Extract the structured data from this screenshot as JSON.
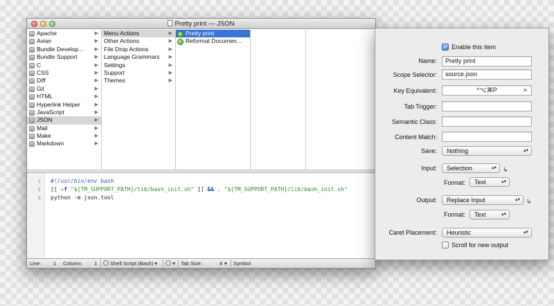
{
  "window": {
    "title": "Pretty print — JSON"
  },
  "bundles": [
    {
      "label": "Apache"
    },
    {
      "label": "Avian"
    },
    {
      "label": "Bundle Develop..."
    },
    {
      "label": "Bundle Support"
    },
    {
      "label": "C"
    },
    {
      "label": "CSS"
    },
    {
      "label": "Diff"
    },
    {
      "label": "Git"
    },
    {
      "label": "HTML"
    },
    {
      "label": "Hyperlink Helper"
    },
    {
      "label": "JavaScript"
    },
    {
      "label": "JSON",
      "selected": true
    },
    {
      "label": "Mail"
    },
    {
      "label": "Make"
    },
    {
      "label": "Markdown"
    }
  ],
  "categories": [
    {
      "label": "Menu Actions",
      "selected": true
    },
    {
      "label": "Other Actions"
    },
    {
      "label": "File Drop Actions"
    },
    {
      "label": "Language Grammars"
    },
    {
      "label": "Settings"
    },
    {
      "label": "Support"
    },
    {
      "label": "Themes"
    }
  ],
  "commands": [
    {
      "label": "Pretty print",
      "selected": true
    },
    {
      "label": "Reformat Documen..."
    }
  ],
  "editor": {
    "line_numbers": [
      "1",
      "2",
      "3"
    ],
    "line1": "#!/usr/bin/env bash",
    "line2": {
      "open": "[[ ",
      "flag": "-f",
      "str1": "\"${TM_SUPPORT_PATH}/lib/bash_init.sh\"",
      "mid": " ]] ",
      "op": "&&",
      "dot": " . ",
      "str2": "\"${TM_SUPPORT_PATH}/lib/bash_init.sh\""
    },
    "line3": "python -m json.tool"
  },
  "statusbar": {
    "line_label": "Line:",
    "line_value": "1",
    "column_label": "Column:",
    "column_value": "1",
    "grammar": "Shell Script (Bash)",
    "tab_size_label": "Tab Size:",
    "tab_size_value": "4",
    "symbol": "Symbol"
  },
  "inspector": {
    "enable_label": "Enable this item",
    "enable_checked": true,
    "name_label": "Name:",
    "name_value": "Pretty print",
    "scope_label": "Scope Selector:",
    "scope_value": "source.json",
    "key_label": "Key Equivalent:",
    "key_value": "^⌥⌘P",
    "key_clear": "✕",
    "tab_trigger_label": "Tab Trigger:",
    "tab_trigger_value": "",
    "semantic_label": "Semantic Class:",
    "semantic_value": "",
    "content_match_label": "Content Match:",
    "content_match_value": "",
    "save_label": "Save:",
    "save_value": "Nothing",
    "input_label": "Input:",
    "input_value": "Selection",
    "input_format_label": "Format:",
    "input_format_value": "Text",
    "output_label": "Output:",
    "output_value": "Replace Input",
    "output_format_label": "Format:",
    "output_format_value": "Text",
    "caret_label": "Caret Placement:",
    "caret_value": "Heuristic",
    "scroll_label": "Scroll for new output",
    "scroll_checked": false
  },
  "icons": {
    "bundle": "bundle-icon",
    "command": "command-icon",
    "gear": "gear-icon",
    "arrow": "chevron-right-icon",
    "updown": "updown-arrows-icon"
  }
}
